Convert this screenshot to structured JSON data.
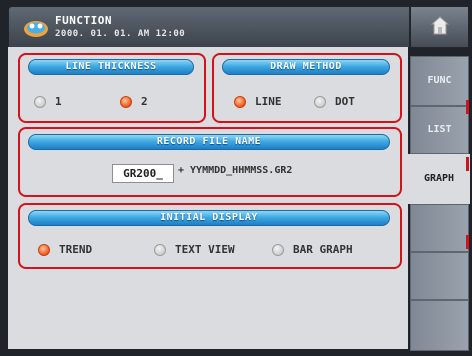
{
  "header": {
    "title": "FUNCTION",
    "datetime": "2000. 01. 01. AM 12:00",
    "logo_icon": "device-logo-icon",
    "home_icon": "home-icon"
  },
  "colors": {
    "highlight_border": "#d3121b",
    "pill_blue": "#3fa9e2",
    "radio_selected": "#f1571b"
  },
  "line_thickness": {
    "title": "LINE THICKNESS",
    "options": [
      {
        "label": "1",
        "selected": false
      },
      {
        "label": "2",
        "selected": true
      }
    ]
  },
  "draw_method": {
    "title": "DRAW METHOD",
    "options": [
      {
        "label": "LINE",
        "selected": true
      },
      {
        "label": "DOT",
        "selected": false
      }
    ]
  },
  "record_file": {
    "title": "RECORD FILE NAME",
    "value": "GR200_",
    "suffix": "+ YYMMDD_HHMMSS.GR2"
  },
  "initial_display": {
    "title": "INITIAL DISPLAY",
    "options": [
      {
        "label": "TREND",
        "selected": true
      },
      {
        "label": "TEXT VIEW",
        "selected": false
      },
      {
        "label": "BAR GRAPH",
        "selected": false
      }
    ]
  },
  "tabs": [
    {
      "label": "FUNC",
      "active": false
    },
    {
      "label": "LIST",
      "active": false
    },
    {
      "label": "GRAPH",
      "active": true
    },
    {
      "label": "",
      "active": false
    },
    {
      "label": "",
      "active": false
    },
    {
      "label": "",
      "active": false
    }
  ]
}
